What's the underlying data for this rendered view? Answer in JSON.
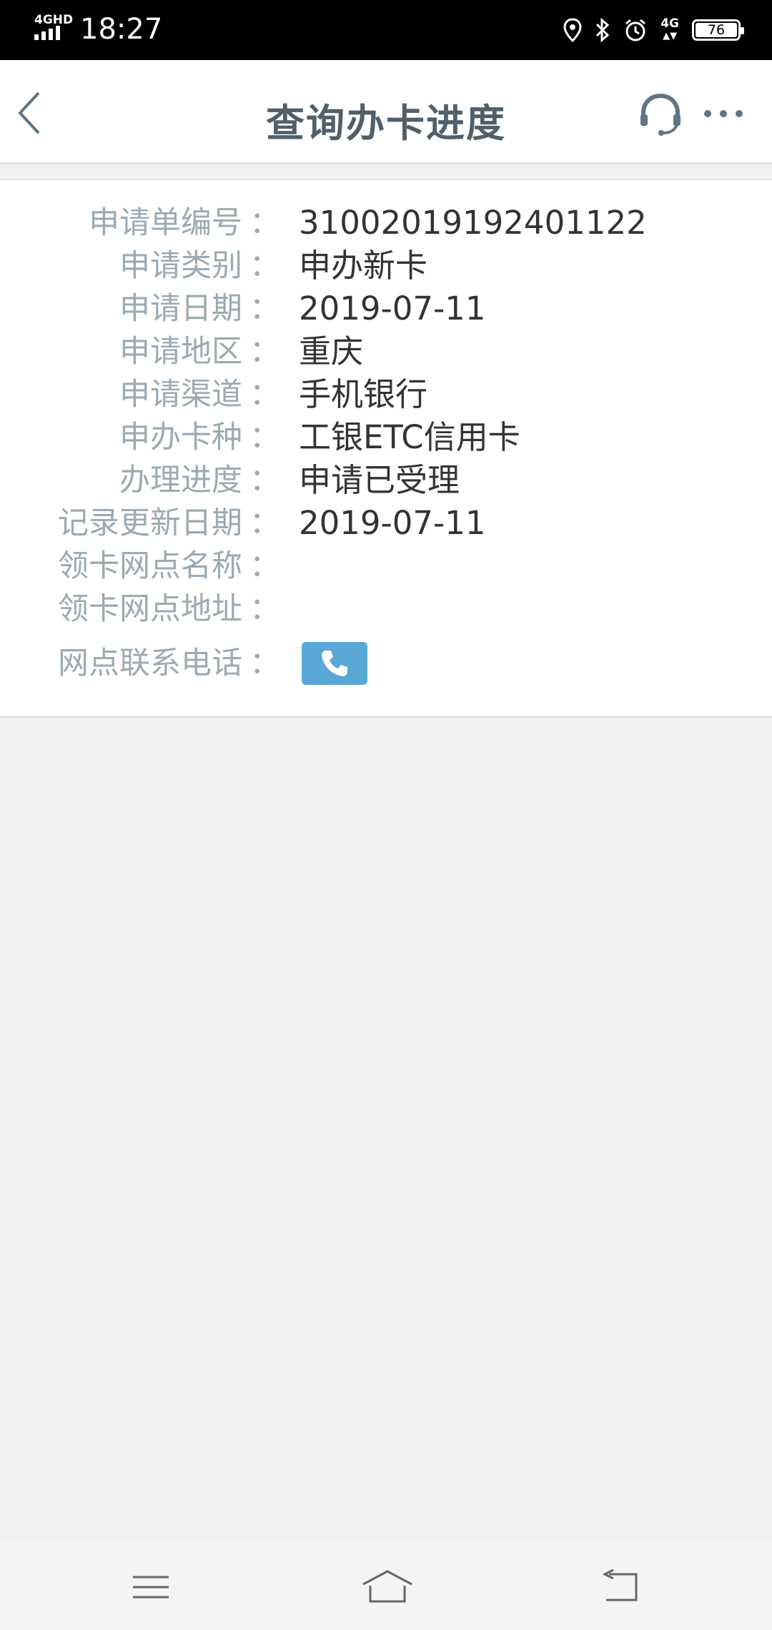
{
  "status_bar": {
    "network_left": "4GHD",
    "time": "18:27",
    "network_right": "4G",
    "battery": "76"
  },
  "header": {
    "title": "查询办卡进度"
  },
  "details": [
    {
      "label": "申请单编号",
      "value": "31002019192401122"
    },
    {
      "label": "申请类别",
      "value": "申办新卡"
    },
    {
      "label": "申请日期",
      "value": "2019-07-11"
    },
    {
      "label": "申请地区",
      "value": "重庆"
    },
    {
      "label": "申请渠道",
      "value": "手机银行"
    },
    {
      "label": "申办卡种",
      "value": "工银ETC信用卡"
    },
    {
      "label": "办理进度",
      "value": "申请已受理"
    },
    {
      "label": "记录更新日期",
      "value": "2019-07-11"
    },
    {
      "label": "领卡网点名称",
      "value": ""
    },
    {
      "label": "领卡网点地址",
      "value": ""
    },
    {
      "label": "网点联系电话",
      "value": ""
    }
  ],
  "colon": "：",
  "icons": {
    "back": "chevron-left-icon",
    "service": "headset-icon",
    "more": "more-dots-icon",
    "phone": "phone-icon",
    "nav_menu": "menu-icon",
    "nav_home": "home-icon",
    "nav_back": "back-icon"
  },
  "colors": {
    "title": "#4f5f6b",
    "label": "#9baab4",
    "value": "#333333",
    "phone_button": "#59a8d6"
  }
}
